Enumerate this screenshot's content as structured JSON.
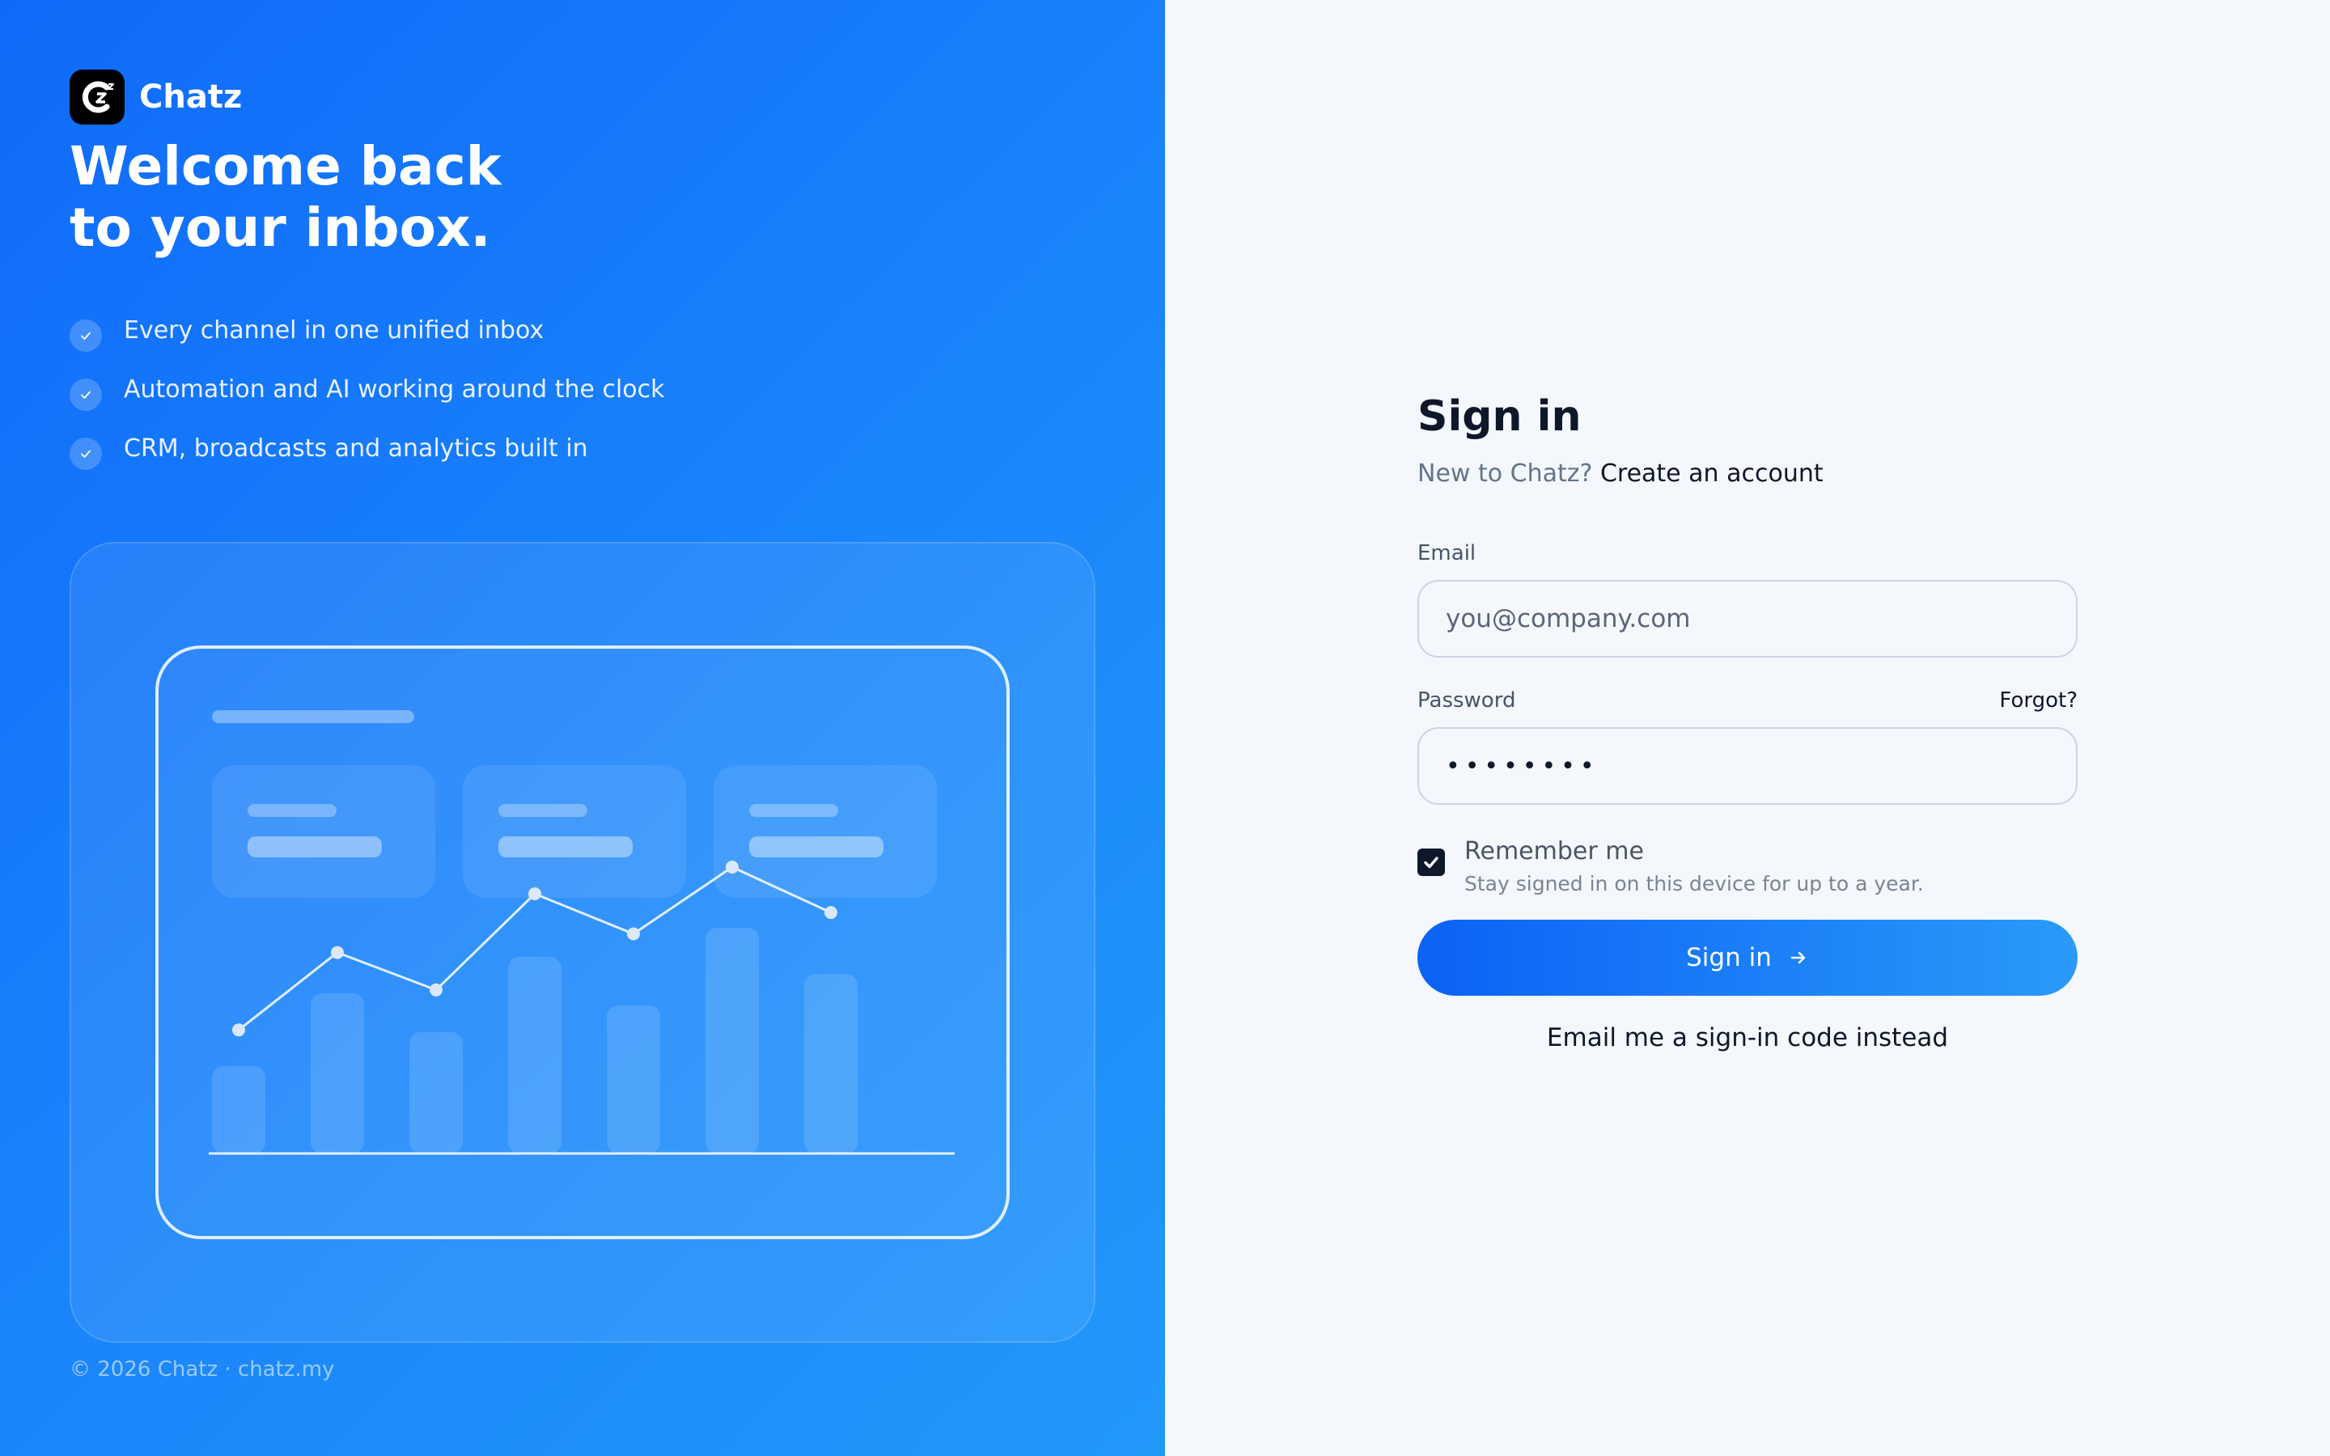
{
  "brand": {
    "name": "Chatz"
  },
  "hero": {
    "line1": "Welcome back",
    "line2": "to your inbox."
  },
  "features": [
    "Every channel in one unified inbox",
    "Automation and AI working around the clock",
    "CRM, broadcasts and analytics built in"
  ],
  "illustration": {
    "icon": "dashboard-chart-illustration",
    "bars": [
      0.36,
      0.66,
      0.5,
      0.81,
      0.61,
      0.93,
      0.74
    ],
    "line": [
      0.39,
      0.68,
      0.54,
      0.9,
      0.75,
      1.0,
      0.83
    ]
  },
  "footer": {
    "text": "© 2026 Chatz · chatz.my"
  },
  "form": {
    "title": "Sign in",
    "new_prompt": "New to Chatz?",
    "create_link": "Create an account",
    "email_label": "Email",
    "email_placeholder": "you@company.com",
    "email_value": "",
    "password_label": "Password",
    "forgot_label": "Forgot?",
    "password_value": "••••••••",
    "remember_label": "Remember me",
    "remember_hint": "Stay signed in on this device for up to a year.",
    "remember_checked": true,
    "signin_label": "Sign in",
    "code_link": "Email me a sign-in code instead"
  },
  "colors": {
    "brand_blue": "#0f6af9",
    "brand_blue_light": "#2398fb",
    "text_dark": "#0f172a",
    "text_muted": "#64748b",
    "panel_bg": "#f4f7fc"
  }
}
